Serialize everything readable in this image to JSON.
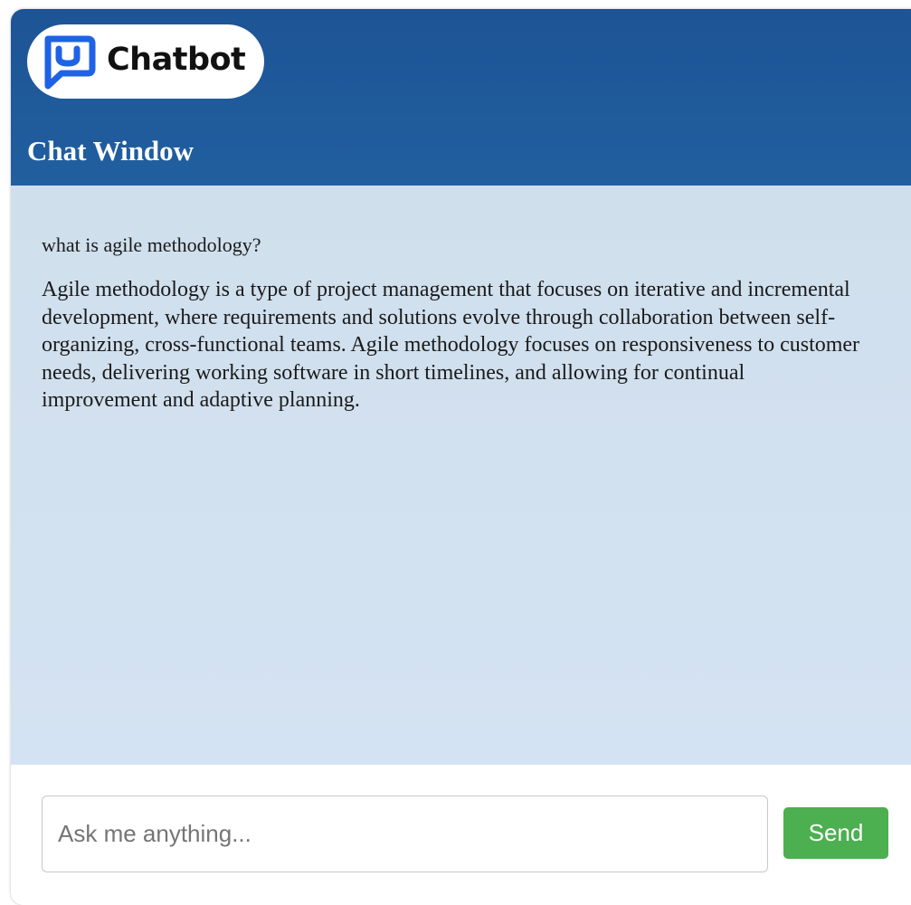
{
  "brand": {
    "logo_text": "Chatbot",
    "accent_color": "#1e62e6",
    "header_color": "#1d5496",
    "logo_icon": "chat-bubble-smile-icon"
  },
  "header": {
    "title": "Chat Window"
  },
  "messages": [
    {
      "role": "user",
      "text": "what is agile methodology?"
    },
    {
      "role": "bot",
      "text": "Agile methodology is a type of project management that focuses on iterative and incremental development, where requirements and solutions evolve through collaboration between self-organizing, cross-functional teams. Agile methodology focuses on responsiveness to customer needs, delivering working software in short timelines, and allowing for continual improvement and adaptive planning."
    }
  ],
  "input": {
    "placeholder": "Ask me anything...",
    "value": ""
  },
  "send_button": {
    "label": "Send",
    "color": "#4caf50"
  }
}
